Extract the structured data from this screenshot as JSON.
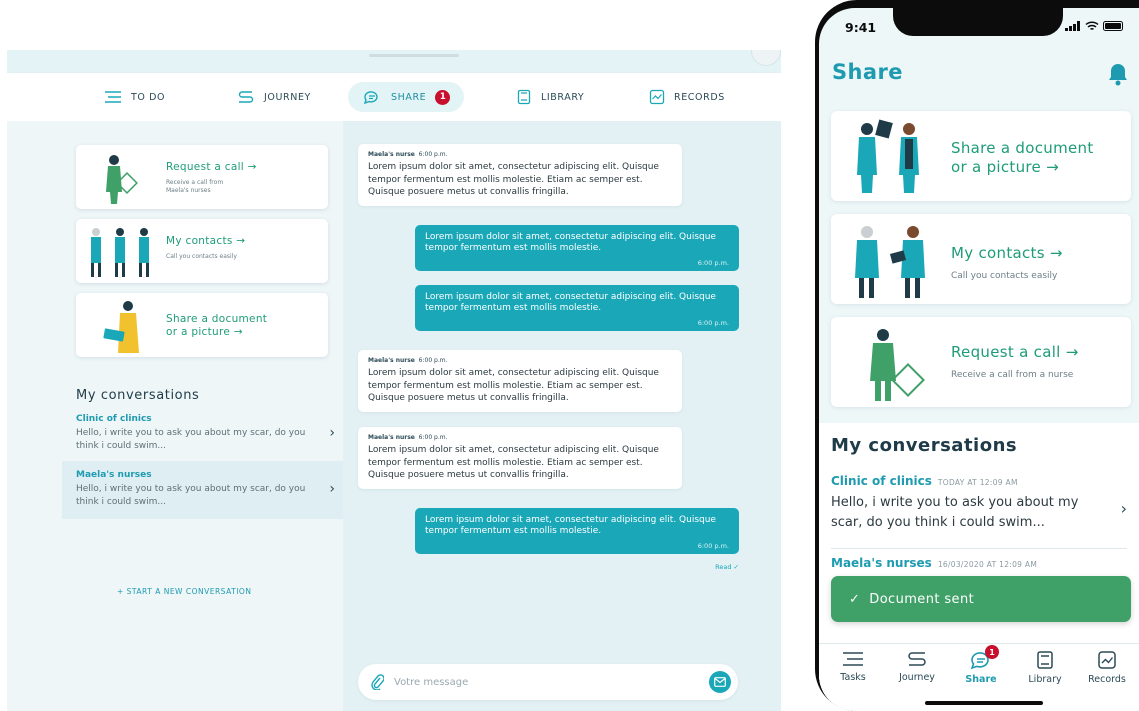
{
  "tablet": {
    "tabs": [
      {
        "label": "TO DO",
        "icon": "list-icon"
      },
      {
        "label": "JOURNEY",
        "icon": "path-icon"
      },
      {
        "label": "SHARE",
        "icon": "chat-icon",
        "badge": "1",
        "active": true
      },
      {
        "label": "LIBRARY",
        "icon": "book-icon"
      },
      {
        "label": "RECORDS",
        "icon": "chart-icon"
      }
    ],
    "cards": [
      {
        "title": "Request a call →",
        "sub": "Receive a call from Maela's nurses"
      },
      {
        "title": "My contacts →",
        "sub": "Call you contacts easily"
      },
      {
        "title": "Share a document or a picture →",
        "sub": ""
      }
    ],
    "conversations_title": "My conversations",
    "conversations": [
      {
        "name": "Clinic of clinics",
        "message": "Hello, i write you to ask you about my scar, do you think i could swim..."
      },
      {
        "name": "Maela's nurses",
        "message": "Hello, i write you to ask you about my scar, do you think i could swim..."
      }
    ],
    "new_conversation": "+ START A NEW CONVERSATION",
    "messages": [
      {
        "dir": "in",
        "sender": "Maela's nurse",
        "time": "6:00 p.m.",
        "text": "Lorem ipsum dolor sit amet, consectetur adipiscing elit. Quisque tempor fermentum est mollis molestie. Etiam ac semper est. Quisque posuere metus ut convallis fringilla."
      },
      {
        "dir": "out",
        "time": "6:00 p.m.",
        "text": "Lorem ipsum dolor sit amet, consectetur adipiscing elit. Quisque tempor fermentum est mollis molestie."
      },
      {
        "dir": "out",
        "time": "6:00 p.m.",
        "text": "Lorem ipsum dolor sit amet, consectetur adipiscing elit. Quisque tempor fermentum est mollis molestie."
      },
      {
        "dir": "in",
        "sender": "Maela's nurse",
        "time": "6:00 p.m.",
        "text": "Lorem ipsum dolor sit amet, consectetur adipiscing elit. Quisque tempor fermentum est mollis molestie. Etiam ac semper est. Quisque posuere metus ut convallis fringilla."
      },
      {
        "dir": "in",
        "sender": "Maela's nurse",
        "time": "6:00 p.m.",
        "text": "Lorem ipsum dolor sit amet, consectetur adipiscing elit. Quisque tempor fermentum est mollis molestie. Etiam ac semper est. Quisque posuere metus ut convallis fringilla."
      },
      {
        "dir": "out",
        "time": "6:00 p.m.",
        "text": "Lorem ipsum dolor sit amet, consectetur adipiscing elit. Quisque tempor fermentum est mollis molestie."
      }
    ],
    "read_label": "Read ✓",
    "composer_placeholder": "Votre message"
  },
  "phone": {
    "status_time": "9:41",
    "title": "Share",
    "cards": [
      {
        "title_1": "Share a document",
        "title_2": "or a picture →",
        "sub": ""
      },
      {
        "title_1": "My contacts →",
        "title_2": "",
        "sub": "Call you contacts easily"
      },
      {
        "title_1": "Request a call →",
        "title_2": "",
        "sub": "Receive a call from a nurse"
      }
    ],
    "conversations_title": "My conversations",
    "conversations": [
      {
        "name": "Clinic of clinics",
        "date": "TODAY AT 12:09 AM",
        "message": "Hello, i write you to ask you about my scar, do you think i could swim..."
      },
      {
        "name": "Maela's nurses",
        "date": "16/03/2020 AT 12:09 AM"
      }
    ],
    "toast": "Document sent",
    "nav": [
      {
        "label": "Tasks",
        "icon": "list-icon"
      },
      {
        "label": "Journey",
        "icon": "path-icon"
      },
      {
        "label": "Share",
        "icon": "chat-icon",
        "badge": "1",
        "active": true
      },
      {
        "label": "Library",
        "icon": "book-icon"
      },
      {
        "label": "Records",
        "icon": "chart-icon"
      }
    ]
  },
  "colors": {
    "primary": "#1aa8b8",
    "green": "#1e9c78",
    "toast": "#3fa167",
    "badge": "#c8102e",
    "background": "#eef6f8"
  }
}
